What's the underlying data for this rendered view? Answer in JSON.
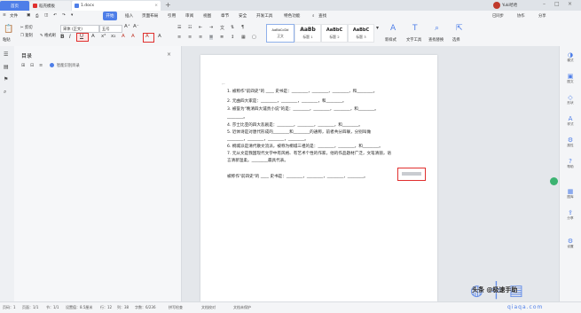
{
  "tabs": [
    {
      "label": "首页"
    },
    {
      "label": "稻壳模板"
    },
    {
      "label": "1.docx"
    }
  ],
  "menu": [
    "文件",
    "开始",
    "插入",
    "页面布局",
    "引用",
    "审阅",
    "视图",
    "章节",
    "安全",
    "开发工具",
    "特色功能",
    "查找"
  ],
  "account": {
    "sync": "已同步",
    "collab": "协作",
    "share": "分享",
    "user": "Yuki哈哈"
  },
  "toolbar": {
    "cut": "剪切",
    "copy": "复制",
    "paste": "粘贴",
    "format_painter": "格式刷",
    "font": "宋体 (正文)",
    "size": "五号",
    "styles": [
      {
        "preview": "AaBbCcDd",
        "label": "正文"
      },
      {
        "preview": "AaBb",
        "label": "标题 1"
      },
      {
        "preview": "AaBbC",
        "label": "标题 2"
      },
      {
        "preview": "AaBbC",
        "label": "标题 3"
      }
    ],
    "new_style": "新样式",
    "text_tool": "文字工具",
    "find_replace": "查找替换",
    "select": "选择"
  },
  "nav": {
    "title": "目录",
    "auto_outline": "智能识别目录"
  },
  "document": {
    "lines": [
      "1. 被称作\"前四史\"的 ____ 史书是：________，________，________，和________。",
      "2. 元曲四大家是：________，________，________，和________。",
      "3. 被誉为\"晚清四大谴责小说\"的是：________，________，________，和________。",
      "________。",
      "4. 莎士比亚的四大悲剧是：________，________，________，和________。",
      "5. 近体诗是对唐代形成的________和________的通称，前者共分四联，分别叫做",
      "________，________，________，________。",
      "6. 桐城派是清代散文流派，被称为桐城三祖的是：________，________，和________。",
      "7. 元从文是我国现代文学中有风格、有艺术个性的作家，他的作品题材广泛，文笔清丽，语",
      "言清新温柔。________最具代表。",
      "被称作\"前四史\"的 ____ 史书是：________，________，________，________。"
    ]
  },
  "right_sidebar": [
    {
      "label": "模式"
    },
    {
      "label": "图文"
    },
    {
      "label": "形状"
    },
    {
      "label": "样式"
    },
    {
      "label": "属性"
    },
    {
      "label": "帮助"
    },
    {
      "label": "图库"
    },
    {
      "label": "分享"
    },
    {
      "label": "设置"
    }
  ],
  "status": {
    "page": "页码：1",
    "pages": "页面：1/1",
    "section": "节：1/1",
    "position": "设置值：8.5厘米",
    "row": "行：12",
    "col": "列：38",
    "words": "字数：6/236",
    "spell": "拼写检查",
    "doc_check": "文档校对",
    "protect": "文档未保护"
  },
  "watermark": {
    "brand": "头条 @极速手助",
    "site": "qiaqa.com"
  }
}
